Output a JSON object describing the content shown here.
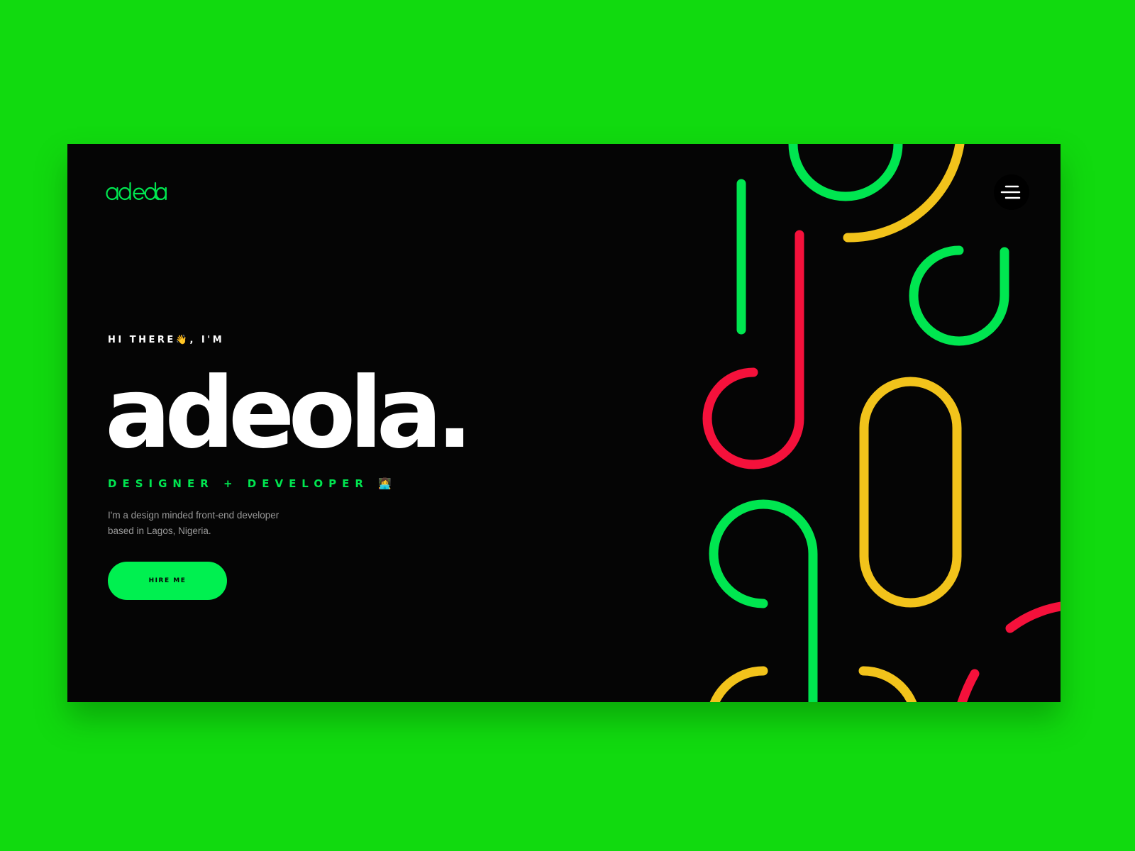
{
  "colors": {
    "background": "#11da0f",
    "panel": "#050505",
    "accent_green": "#00e650",
    "accent_red": "#f5113b",
    "accent_yellow": "#f2c31b",
    "text_primary": "#ffffff",
    "text_muted": "#9a9a9a"
  },
  "header": {
    "logo_text": "adeola",
    "menu_icon": "hamburger-menu-icon"
  },
  "hero": {
    "greeting": "HI THERE👋, I'M",
    "name": "adeola.",
    "role": "DESIGNER + DEVELOPER 👩‍💻",
    "bio": "I'm a design minded front-end developer based in Lagos, Nigeria.",
    "cta_label": "HIRE ME"
  }
}
